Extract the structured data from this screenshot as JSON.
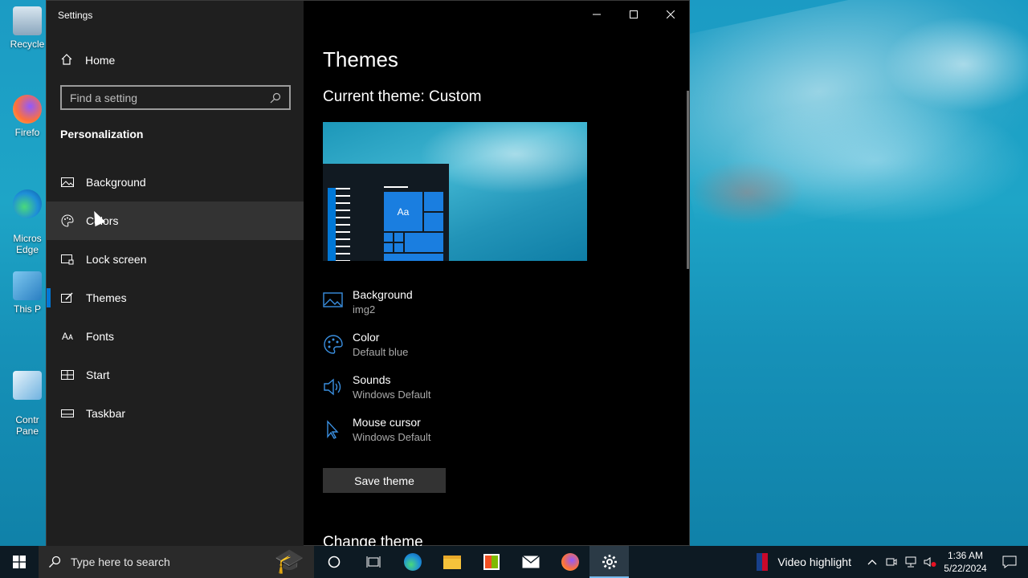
{
  "desktop": {
    "icons": [
      {
        "label": "Recycle"
      },
      {
        "label": "Firefo"
      },
      {
        "label": "Micros\nEdge"
      },
      {
        "label": "This P"
      },
      {
        "label": "Contr\nPane"
      }
    ]
  },
  "window": {
    "title": "Settings",
    "controls": {
      "minimize": "—",
      "maximize": "☐",
      "close": "✕"
    }
  },
  "nav": {
    "home_label": "Home",
    "search_placeholder": "Find a setting",
    "section_title": "Personalization",
    "items": [
      {
        "label": "Background",
        "icon": "image-icon"
      },
      {
        "label": "Colors",
        "icon": "palette-icon"
      },
      {
        "label": "Lock screen",
        "icon": "lock-screen-icon"
      },
      {
        "label": "Themes",
        "icon": "themes-icon"
      },
      {
        "label": "Fonts",
        "icon": "fonts-icon"
      },
      {
        "label": "Start",
        "icon": "start-icon"
      },
      {
        "label": "Taskbar",
        "icon": "taskbar-icon"
      }
    ]
  },
  "content": {
    "heading": "Themes",
    "current_theme": "Current theme: Custom",
    "preview": {
      "sample_text": "Aa"
    },
    "properties": [
      {
        "name": "Background",
        "value": "img2",
        "icon": "image-icon"
      },
      {
        "name": "Color",
        "value": "Default blue",
        "icon": "palette-icon"
      },
      {
        "name": "Sounds",
        "value": "Windows Default",
        "icon": "speaker-icon"
      },
      {
        "name": "Mouse cursor",
        "value": "Windows Default",
        "icon": "cursor-icon"
      }
    ],
    "save_label": "Save theme",
    "change_theme": "Change theme"
  },
  "taskbar": {
    "search_placeholder": "Type here to search",
    "news_label": "Video highlight",
    "time": "1:36 AM",
    "date": "5/22/2024"
  },
  "colors": {
    "accent": "#0078d7",
    "nav_bg": "#1f1f1f",
    "content_bg": "#000000",
    "taskbar_bg": "#0d1a23"
  }
}
